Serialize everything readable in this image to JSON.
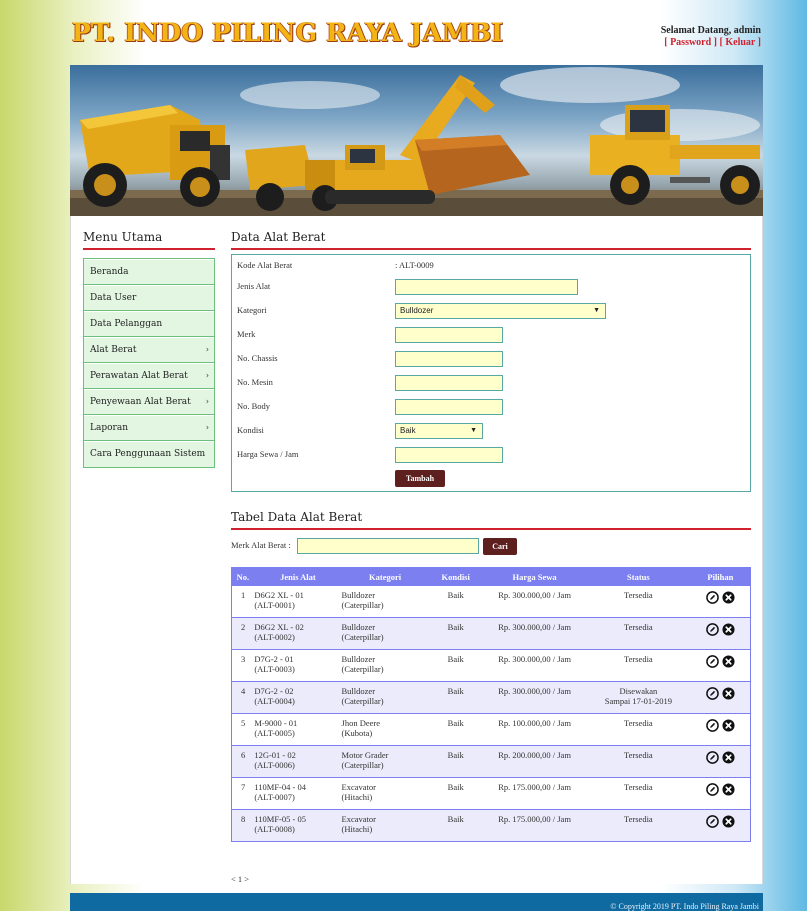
{
  "header": {
    "site_title": "PT. INDO PILING RAYA JAMBI",
    "welcome": "Selamat Datang, admin",
    "password_link": "[ Password ]",
    "logout_link": "[ Keluar ]"
  },
  "sidebar": {
    "title": "Menu Utama",
    "items": [
      {
        "label": "Beranda",
        "arrow": false
      },
      {
        "label": "Data User",
        "arrow": false
      },
      {
        "label": "Data Pelanggan",
        "arrow": false
      },
      {
        "label": "Alat Berat",
        "arrow": true
      },
      {
        "label": "Perawatan Alat Berat",
        "arrow": true
      },
      {
        "label": "Penyewaan Alat Berat",
        "arrow": true
      },
      {
        "label": "Laporan",
        "arrow": true
      },
      {
        "label": "Cara Penggunaan Sistem",
        "arrow": false
      }
    ],
    "arrow_glyph": "›"
  },
  "form": {
    "title": "Data Alat Berat",
    "kode_label": "Kode Alat Berat",
    "kode_value": ": ALT-0009",
    "jenis_label": "Jenis Alat",
    "kategori_label": "Kategori",
    "kategori_value": "Bulldozer",
    "merk_label": "Merk",
    "chassis_label": "No. Chassis",
    "mesin_label": "No. Mesin",
    "body_label": "No. Body",
    "kondisi_label": "Kondisi",
    "kondisi_value": "Baik",
    "harga_label": "Harga Sewa / Jam",
    "submit_label": "Tambah",
    "caret": "▼"
  },
  "table_section": {
    "title": "Tabel Data Alat Berat",
    "search_label": "Merk Alat Berat :",
    "search_button": "Cari",
    "columns": [
      "No.",
      "Jenis Alat",
      "Kategori",
      "Kondisi",
      "Harga Sewa",
      "Status",
      "Pilihan"
    ],
    "rows": [
      {
        "no": "1",
        "jenis": "D6G2 XL - 01",
        "kode": "(ALT-0001)",
        "kategori": "Bulldozer",
        "merk": "(Caterpillar)",
        "kondisi": "Baik",
        "harga": "Rp. 300.000,00 / Jam",
        "status": "Tersedia",
        "status2": ""
      },
      {
        "no": "2",
        "jenis": "D6G2 XL - 02",
        "kode": "(ALT-0002)",
        "kategori": "Bulldozer",
        "merk": "(Caterpillar)",
        "kondisi": "Baik",
        "harga": "Rp. 300.000,00 / Jam",
        "status": "Tersedia",
        "status2": ""
      },
      {
        "no": "3",
        "jenis": "D7G-2 - 01",
        "kode": "(ALT-0003)",
        "kategori": "Bulldozer",
        "merk": "(Caterpillar)",
        "kondisi": "Baik",
        "harga": "Rp. 300.000,00 / Jam",
        "status": "Tersedia",
        "status2": ""
      },
      {
        "no": "4",
        "jenis": "D7G-2 - 02",
        "kode": "(ALT-0004)",
        "kategori": "Bulldozer",
        "merk": "(Caterpillar)",
        "kondisi": "Baik",
        "harga": "Rp. 300.000,00 / Jam",
        "status": "Disewakan",
        "status2": "Sampai 17-01-2019"
      },
      {
        "no": "5",
        "jenis": "M-9000 - 01",
        "kode": "(ALT-0005)",
        "kategori": "Jhon Deere",
        "merk": "(Kubota)",
        "kondisi": "Baik",
        "harga": "Rp. 100.000,00 / Jam",
        "status": "Tersedia",
        "status2": ""
      },
      {
        "no": "6",
        "jenis": "12G-01 - 02",
        "kode": "(ALT-0006)",
        "kategori": "Motor Grader",
        "merk": "(Caterpillar)",
        "kondisi": "Baik",
        "harga": "Rp. 200.000,00 / Jam",
        "status": "Tersedia",
        "status2": ""
      },
      {
        "no": "7",
        "jenis": "110MF-04 - 04",
        "kode": "(ALT-0007)",
        "kategori": "Excavator",
        "merk": "(Hitachi)",
        "kondisi": "Baik",
        "harga": "Rp. 175.000,00 / Jam",
        "status": "Tersedia",
        "status2": ""
      },
      {
        "no": "8",
        "jenis": "110MF-05 - 05",
        "kode": "(ALT-0008)",
        "kategori": "Excavator",
        "merk": "(Hitachi)",
        "kondisi": "Baik",
        "harga": "Rp. 175.000,00 / Jam",
        "status": "Tersedia",
        "status2": ""
      }
    ],
    "pagination": "< 1 >"
  },
  "footer": {
    "copyright": "© Copyright 2019 PT. Indo Piling Raya Jambi"
  },
  "colors": {
    "accent_red": "#d0222e",
    "title_gold": "#f2b515",
    "button_dark": "#5e1f1f",
    "table_header": "#7b7ff0",
    "footer_blue": "#0f6aa2"
  }
}
